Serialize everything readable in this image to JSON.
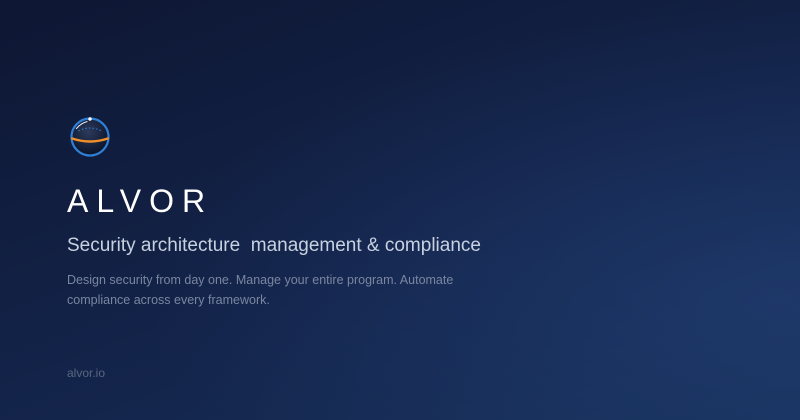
{
  "brand": {
    "logo_icon": "globe-orbit-icon",
    "name": "ALVOR"
  },
  "hero": {
    "tagline": "Security architecture  management & compliance",
    "description": "Design security from day one. Manage your entire program. Automate compliance across every framework."
  },
  "footer": {
    "domain": "alvor.io"
  },
  "colors": {
    "background_top": "#0e1733",
    "background_bottom": "#173059",
    "logo_blue": "#2f7fd6",
    "logo_orange": "#f0902a"
  }
}
